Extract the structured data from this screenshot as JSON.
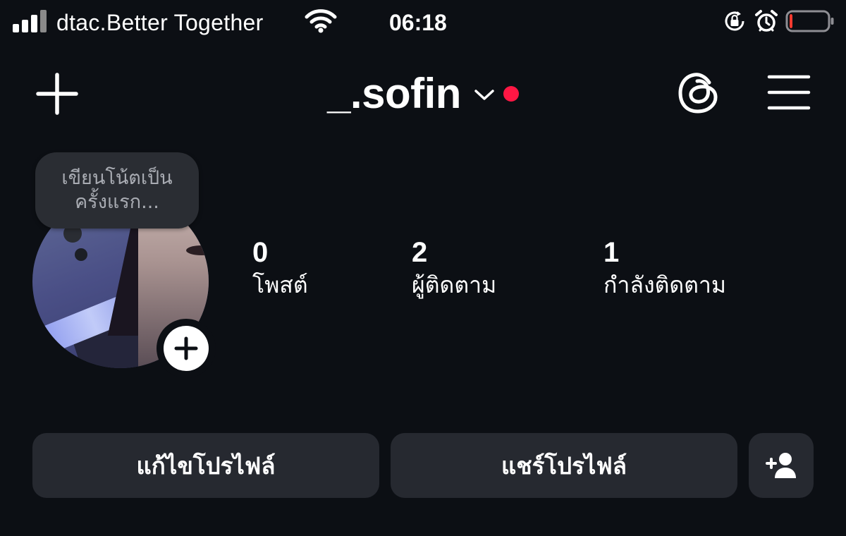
{
  "status_bar": {
    "carrier": "dtac.Better Together",
    "time": "06:18",
    "signal_bars": 4,
    "battery_level": 0.08,
    "battery_color": "#ff3b30",
    "icons": [
      "signal-icon",
      "wifi-icon",
      "orientation-lock-icon",
      "alarm-icon",
      "battery-icon"
    ]
  },
  "header": {
    "username": "_.sofin",
    "new_content_icon": "plus-icon",
    "switch_account_icon": "chevron-down-icon",
    "notification_dot_color": "#ff1744",
    "threads_icon": "threads-icon",
    "menu_icon": "hamburger-menu-icon"
  },
  "profile": {
    "note_placeholder": "เขียนโน้ตเป็น\nครั้งแรก...",
    "add_story_icon": "plus-icon"
  },
  "stats": [
    {
      "value": "0",
      "label": "โพสต์"
    },
    {
      "value": "2",
      "label": "ผู้ติดตาม"
    },
    {
      "value": "1",
      "label": "กำลังติดตาม"
    }
  ],
  "actions": {
    "edit_profile": "แก้ไขโปรไฟล์",
    "share_profile": "แชร์โปรไฟล์",
    "discover_people_icon": "add-person-icon"
  }
}
